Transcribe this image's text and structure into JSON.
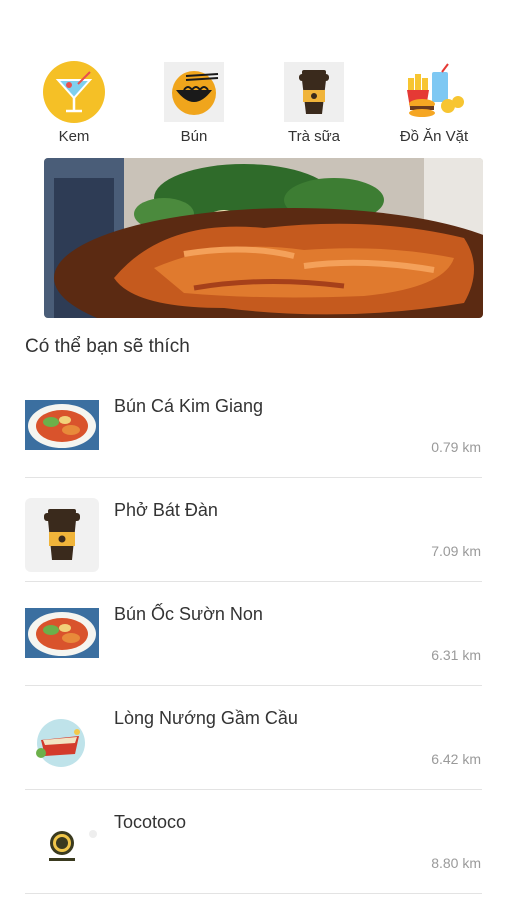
{
  "categories": [
    {
      "label": "Kem",
      "icon": "cocktail-icon"
    },
    {
      "label": "Bún",
      "icon": "noodle-bowl-icon"
    },
    {
      "label": "Trà sữa",
      "icon": "milk-tea-cup-icon"
    },
    {
      "label": "Đồ Ăn Vặt",
      "icon": "snacks-icon"
    }
  ],
  "banner": {
    "image": "roast-duck-photo"
  },
  "section": {
    "title": "Có thể bạn sẽ thích"
  },
  "restaurants": [
    {
      "name": "Bún Cá Kim Giang",
      "distance": "0.79 km",
      "thumb": "noodle-dish-photo"
    },
    {
      "name": "Phở Bát Đàn",
      "distance": "7.09 km",
      "thumb": "milk-tea-cup-icon"
    },
    {
      "name": "Bún Ốc Sườn Non",
      "distance": "6.31 km",
      "thumb": "noodle-dish-photo"
    },
    {
      "name": "Lòng Nướng Gầm Cầu",
      "distance": "6.42 km",
      "thumb": "grill-plate-icon"
    },
    {
      "name": "Tocotoco",
      "distance": "8.80 km",
      "thumb": "tocotoco-logo"
    }
  ],
  "colors": {
    "accent": "#f5c026",
    "text": "#333333",
    "muted": "#9a9a9a",
    "divider": "#e3e3e3"
  }
}
